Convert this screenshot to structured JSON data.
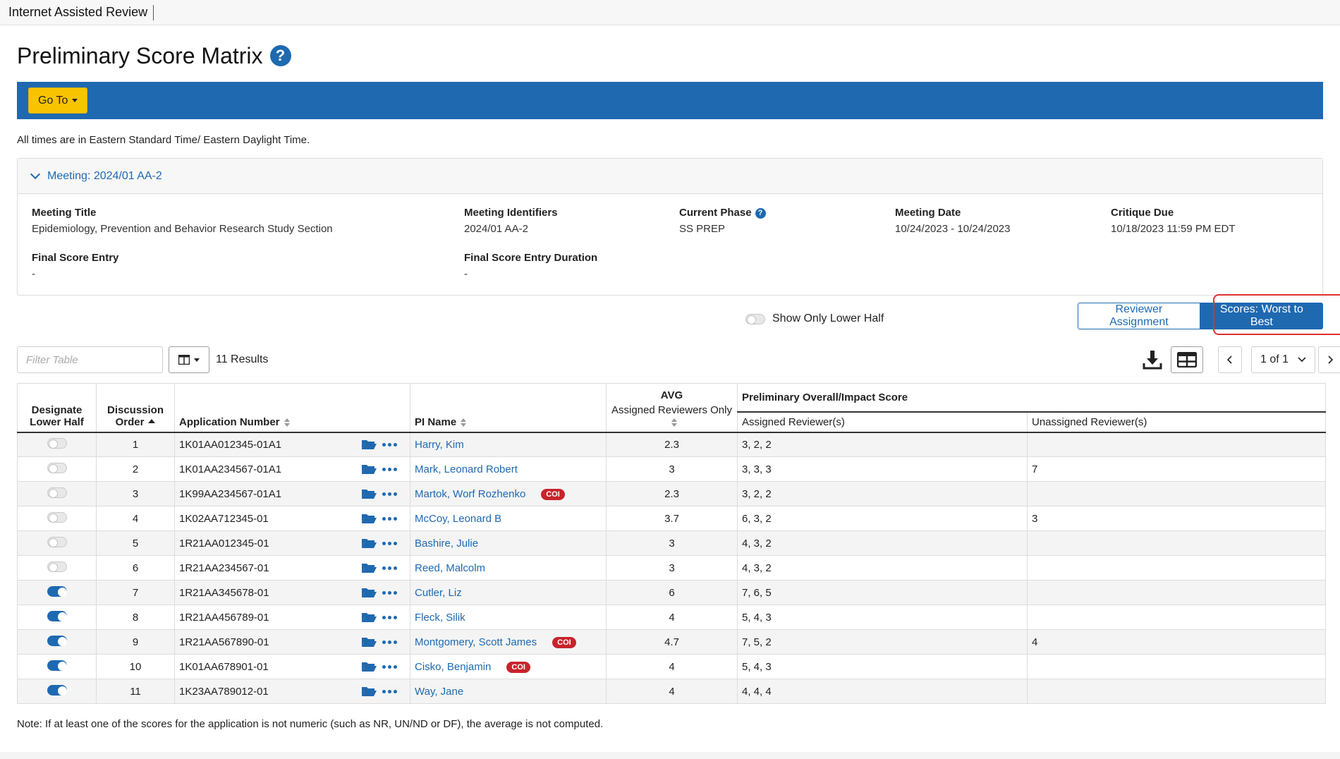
{
  "app": {
    "title": "Internet Assisted Review"
  },
  "page": {
    "title": "Preliminary Score Matrix",
    "help_glyph": "?"
  },
  "toolbar": {
    "goto_label": "Go To"
  },
  "timezone_note": "All times are in Eastern Standard Time/ Eastern Daylight Time.",
  "meeting": {
    "header": "Meeting:  2024/01 AA-2",
    "fields": {
      "title_label": "Meeting Title",
      "title_value": "Epidemiology, Prevention and Behavior Research Study Section",
      "identifiers_label": "Meeting Identifiers",
      "identifiers_value": "2024/01 AA-2",
      "phase_label": "Current Phase",
      "phase_value": "SS PREP",
      "date_label": "Meeting Date",
      "date_value": "10/24/2023 - 10/24/2023",
      "critique_label": "Critique Due",
      "critique_value": "10/18/2023 11:59 PM EDT",
      "final_entry_label": "Final Score Entry",
      "final_entry_value": "-",
      "final_duration_label": "Final Score Entry Duration",
      "final_duration_value": "-"
    }
  },
  "controls": {
    "lower_half_label": "Show Only Lower Half",
    "reviewer_assignment_label": "Reviewer Assignment",
    "scores_label": "Scores: Worst to Best",
    "filter_placeholder": "Filter Table",
    "results": "11 Results",
    "page_select": "1 of 1"
  },
  "table": {
    "headers": {
      "designate": "Designate Lower Half",
      "discussion": "Discussion Order",
      "app_number": "Application Number",
      "pi_name": "PI Name",
      "avg_top": "AVG",
      "avg_sub": "Assigned Reviewers Only",
      "prelim": "Preliminary Overall/Impact Score",
      "assigned": "Assigned Reviewer(s)",
      "unassigned": "Unassigned Reviewer(s)"
    },
    "coi_label": "COI",
    "rows": [
      {
        "toggle": false,
        "order": "1",
        "app": "1K01AA012345-01A1",
        "pi": "Harry, Kim",
        "coi": false,
        "avg": "2.3",
        "assigned": "3, 2, 2",
        "unassigned": ""
      },
      {
        "toggle": false,
        "order": "2",
        "app": "1K01AA234567-01A1",
        "pi": "Mark, Leonard Robert",
        "coi": false,
        "avg": "3",
        "assigned": "3, 3, 3",
        "unassigned": "7"
      },
      {
        "toggle": false,
        "order": "3",
        "app": "1K99AA234567-01A1",
        "pi": "Martok, Worf Rozhenko",
        "coi": true,
        "avg": "2.3",
        "assigned": "3, 2, 2",
        "unassigned": ""
      },
      {
        "toggle": false,
        "order": "4",
        "app": "1K02AA712345-01",
        "pi": "McCoy, Leonard B",
        "coi": false,
        "avg": "3.7",
        "assigned": "6, 3, 2",
        "unassigned": "3"
      },
      {
        "toggle": false,
        "order": "5",
        "app": "1R21AA012345-01",
        "pi": "Bashire, Julie",
        "coi": false,
        "avg": "3",
        "assigned": "4, 3, 2",
        "unassigned": ""
      },
      {
        "toggle": false,
        "order": "6",
        "app": "1R21AA234567-01",
        "pi": "Reed, Malcolm",
        "coi": false,
        "avg": "3",
        "assigned": "4, 3, 2",
        "unassigned": ""
      },
      {
        "toggle": true,
        "order": "7",
        "app": "1R21AA345678-01",
        "pi": "Cutler, Liz",
        "coi": false,
        "avg": "6",
        "assigned": "7, 6, 5",
        "unassigned": ""
      },
      {
        "toggle": true,
        "order": "8",
        "app": "1R21AA456789-01",
        "pi": "Fleck, Silik",
        "coi": false,
        "avg": "4",
        "assigned": "5, 4, 3",
        "unassigned": ""
      },
      {
        "toggle": true,
        "order": "9",
        "app": "1R21AA567890-01",
        "pi": "Montgomery, Scott James",
        "coi": true,
        "avg": "4.7",
        "assigned": "7, 5, 2",
        "unassigned": "4"
      },
      {
        "toggle": true,
        "order": "10",
        "app": "1K01AA678901-01",
        "pi": "Cisko, Benjamin",
        "coi": true,
        "avg": "4",
        "assigned": "5, 4, 3",
        "unassigned": ""
      },
      {
        "toggle": true,
        "order": "11",
        "app": "1K23AA789012-01",
        "pi": "Way, Jane",
        "coi": false,
        "avg": "4",
        "assigned": "4, 4, 4",
        "unassigned": ""
      }
    ]
  },
  "footnote": "Note: If at least one of the scores for the application is not numeric (such as NR, UN/ND or DF), the average is not computed.",
  "colors": {
    "primary": "#1f69b1",
    "accent": "#f8c400",
    "coi": "#c8232c",
    "highlight": "#e03030"
  }
}
